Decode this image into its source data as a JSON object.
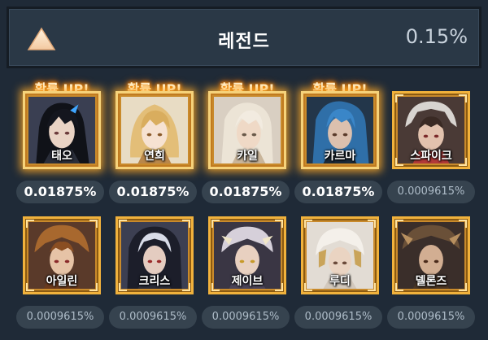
{
  "header": {
    "grade": "레전드",
    "rate": "0.15%",
    "icon": "triangle-up-icon"
  },
  "up_label": "확률 UP!",
  "colors": {
    "background": "#1f2a37",
    "frame_gold": "#f1b23c",
    "glow_orange": "#ff8a00",
    "pill": "#36434f"
  },
  "characters": [
    {
      "name": "태오",
      "rate": "0.01875%",
      "rate_up": true
    },
    {
      "name": "연희",
      "rate": "0.01875%",
      "rate_up": true
    },
    {
      "name": "카일",
      "rate": "0.01875%",
      "rate_up": true
    },
    {
      "name": "카르마",
      "rate": "0.01875%",
      "rate_up": true
    },
    {
      "name": "스파이크",
      "rate": "0.0009615%",
      "rate_up": false
    },
    {
      "name": "아일린",
      "rate": "0.0009615%",
      "rate_up": false
    },
    {
      "name": "크리스",
      "rate": "0.0009615%",
      "rate_up": false
    },
    {
      "name": "제이브",
      "rate": "0.0009615%",
      "rate_up": false
    },
    {
      "name": "루디",
      "rate": "0.0009615%",
      "rate_up": false
    },
    {
      "name": "델론즈",
      "rate": "0.0009615%",
      "rate_up": false
    }
  ]
}
